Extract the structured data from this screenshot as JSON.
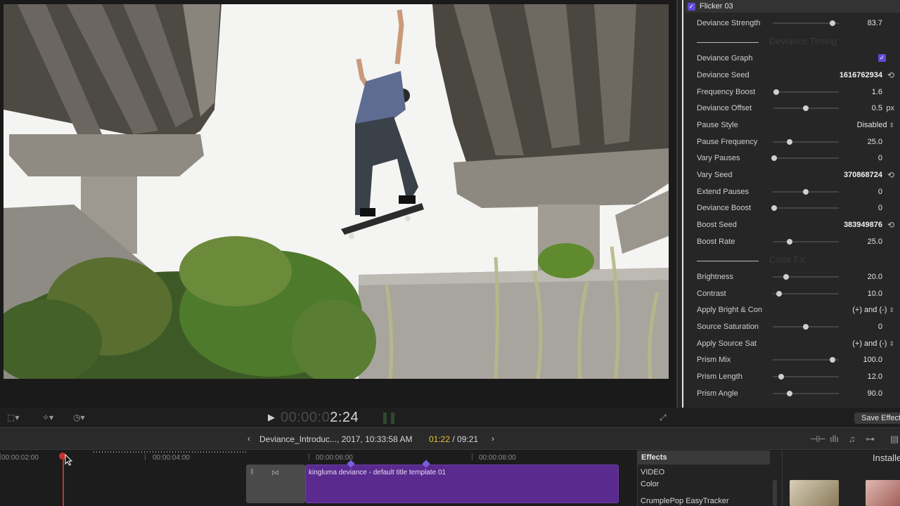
{
  "inspector": {
    "effect_title": "Flicker 03",
    "ghost_section_1": "Deviance Timing",
    "ghost_section_2": "Color FX",
    "params": [
      {
        "label": "Deviance Strength",
        "value": "83.7",
        "slider": 0.9
      },
      {
        "label": "Deviance Graph",
        "checkbox": true
      },
      {
        "label": "Deviance Seed",
        "value": "1616762934",
        "bold": true,
        "reset": true
      },
      {
        "label": "Frequency Boost",
        "value": "1.6",
        "slider": 0.05
      },
      {
        "label": "Deviance Offset",
        "value": "0.5",
        "unit": "px",
        "slider": 0.5
      },
      {
        "label": "Pause Style",
        "popup": "Disabled"
      },
      {
        "label": "Pause Frequency",
        "value": "25.0",
        "slider": 0.25
      },
      {
        "label": "Vary Pauses",
        "value": "0",
        "slider": 0.0
      },
      {
        "label": "Vary Seed",
        "value": "370868724",
        "bold": true,
        "reset": true
      },
      {
        "label": "Extend Pauses",
        "value": "0",
        "slider": 0.5
      },
      {
        "label": "Deviance Boost",
        "value": "0",
        "slider": 0.0
      },
      {
        "label": "Boost Seed",
        "value": "383949876",
        "bold": true,
        "reset": true
      },
      {
        "label": "Boost Rate",
        "value": "25.0",
        "slider": 0.25
      },
      {
        "label": "Brightness",
        "value": "20.0",
        "slider": 0.2
      },
      {
        "label": "Contrast",
        "value": "10.0",
        "slider": 0.1
      },
      {
        "label": "Apply Bright & Con",
        "popup": "(+) and (-)"
      },
      {
        "label": "Source Saturation",
        "value": "0",
        "slider": 0.5
      },
      {
        "label": "Apply Source Sat",
        "popup": "(+) and (-)"
      },
      {
        "label": "Prism Mix",
        "value": "100.0",
        "slider": 0.9
      },
      {
        "label": "Prism Length",
        "value": "12.0",
        "slider": 0.1
      },
      {
        "label": "Prism Angle",
        "value": "90.0",
        "slider": 0.25
      }
    ]
  },
  "viewer": {
    "timecode_dim": "00:00:0",
    "timecode_lit": "2:24",
    "save_button": "Save Effect"
  },
  "timeline_header": {
    "project": "Deviance_Introduc..., 2017, 10:33:58 AM",
    "current": "01:22",
    "separator": " / ",
    "total": "09:21"
  },
  "timeline": {
    "ruler_labels": [
      "00:00:02:00",
      "00:00:04:00",
      "00:00:06:00",
      "00:00:08:00"
    ],
    "clip_label": "kingluma deviance - default title template 01"
  },
  "effects": {
    "header": "Effects",
    "category": "VIDEO",
    "items": [
      "Color",
      "CrumplePop EasyTracker"
    ],
    "installed": "Installed"
  }
}
